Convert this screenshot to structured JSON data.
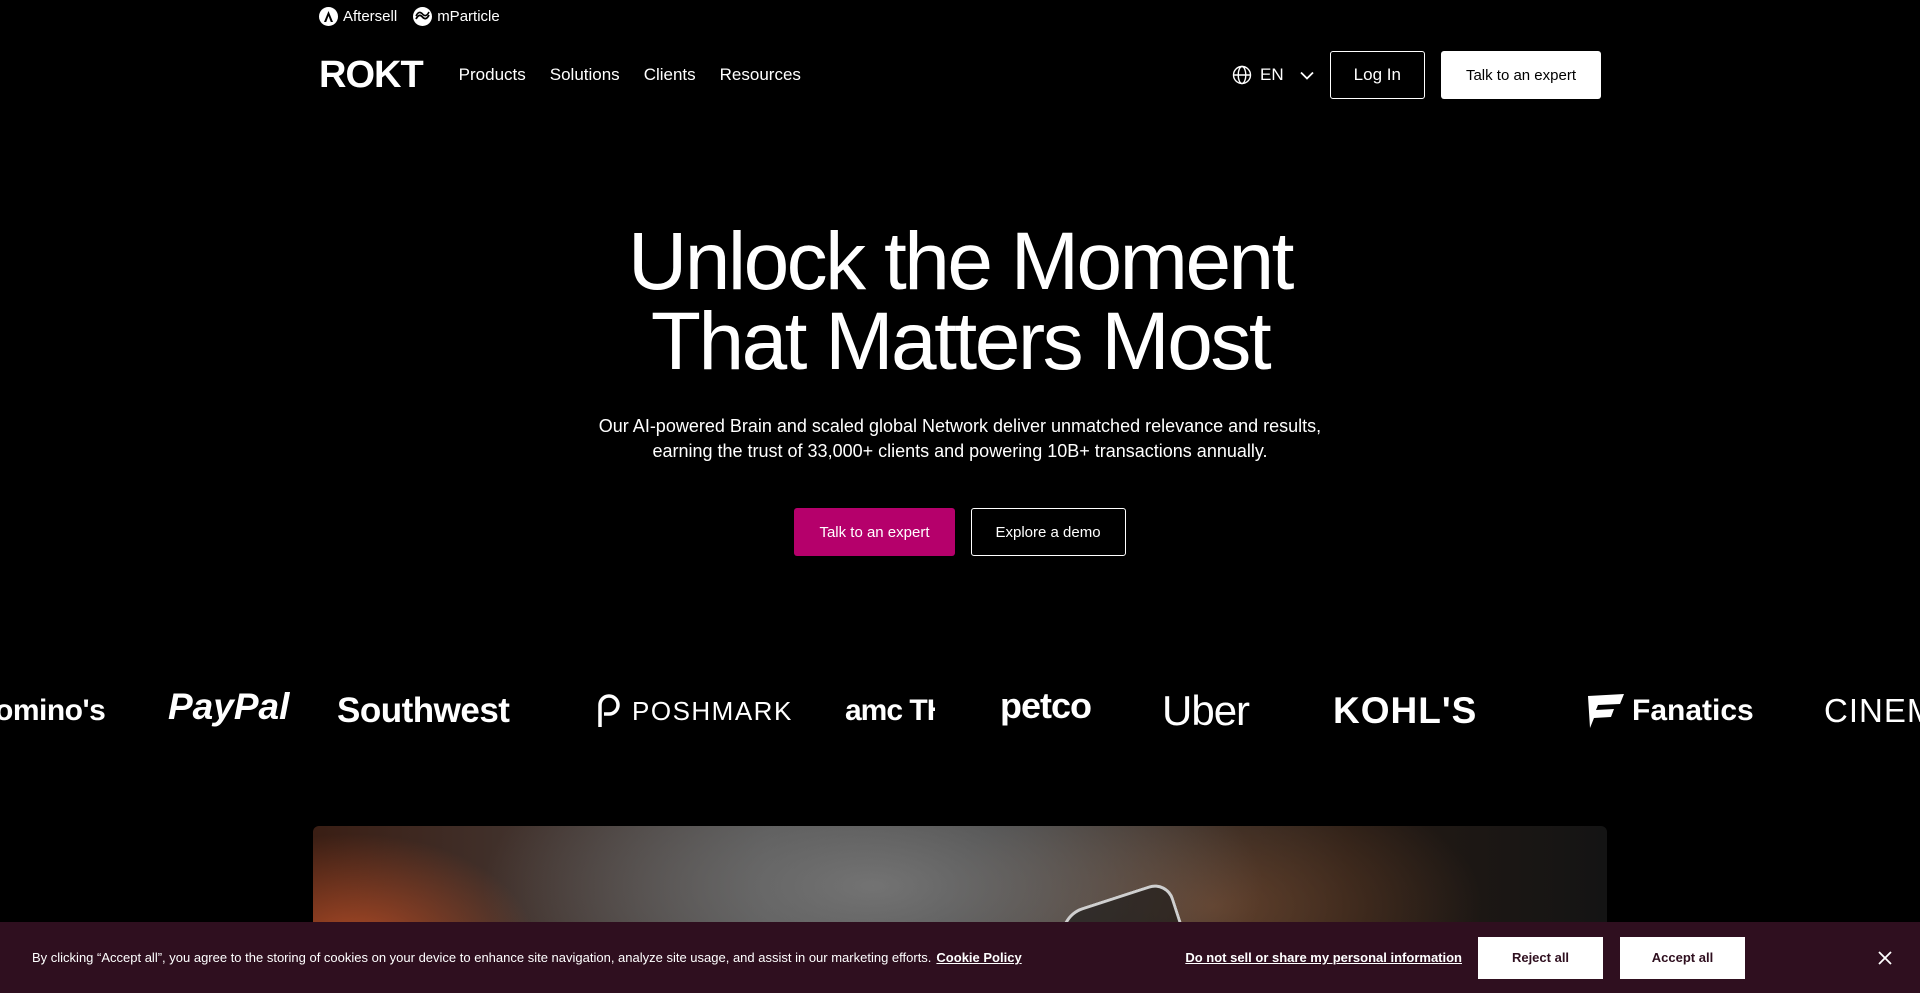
{
  "utility_bar": {
    "links": [
      {
        "label": "Aftersell",
        "icon": "aftersell-icon"
      },
      {
        "label": "mParticle",
        "icon": "mparticle-icon"
      }
    ]
  },
  "nav": {
    "logo": "ROKT",
    "links": [
      "Products",
      "Solutions",
      "Clients",
      "Resources"
    ],
    "language": "EN",
    "login_label": "Log In",
    "cta_label": "Talk to an expert"
  },
  "hero": {
    "title_line1": "Unlock the Moment",
    "title_line2": "That Matters Most",
    "subtitle_line1": "Our AI-powered Brain and scaled global Network deliver unmatched relevance and results,",
    "subtitle_line2": "earning the trust of 33,000+ clients and powering 10B+ transactions annually.",
    "primary_cta": "Talk to an expert",
    "secondary_cta": "Explore a demo",
    "accent_color": "#b5006b"
  },
  "client_logos": [
    "omino's",
    "PayPal",
    "Southwest",
    "POSHMARK",
    "amc THEATRES",
    "petco",
    "Uber",
    "KOHL'S",
    "Fanatics",
    "CINEM"
  ],
  "cookie_banner": {
    "text": "By clicking “Accept all”, you agree to the storing of cookies on your device to enhance site navigation, analyze site usage, and assist in our marketing efforts.",
    "policy_link": "Cookie Policy",
    "do_not_sell": "Do not sell or share my personal information",
    "reject_label": "Reject all",
    "accept_label": "Accept all",
    "background_color": "#2f0f1f"
  }
}
